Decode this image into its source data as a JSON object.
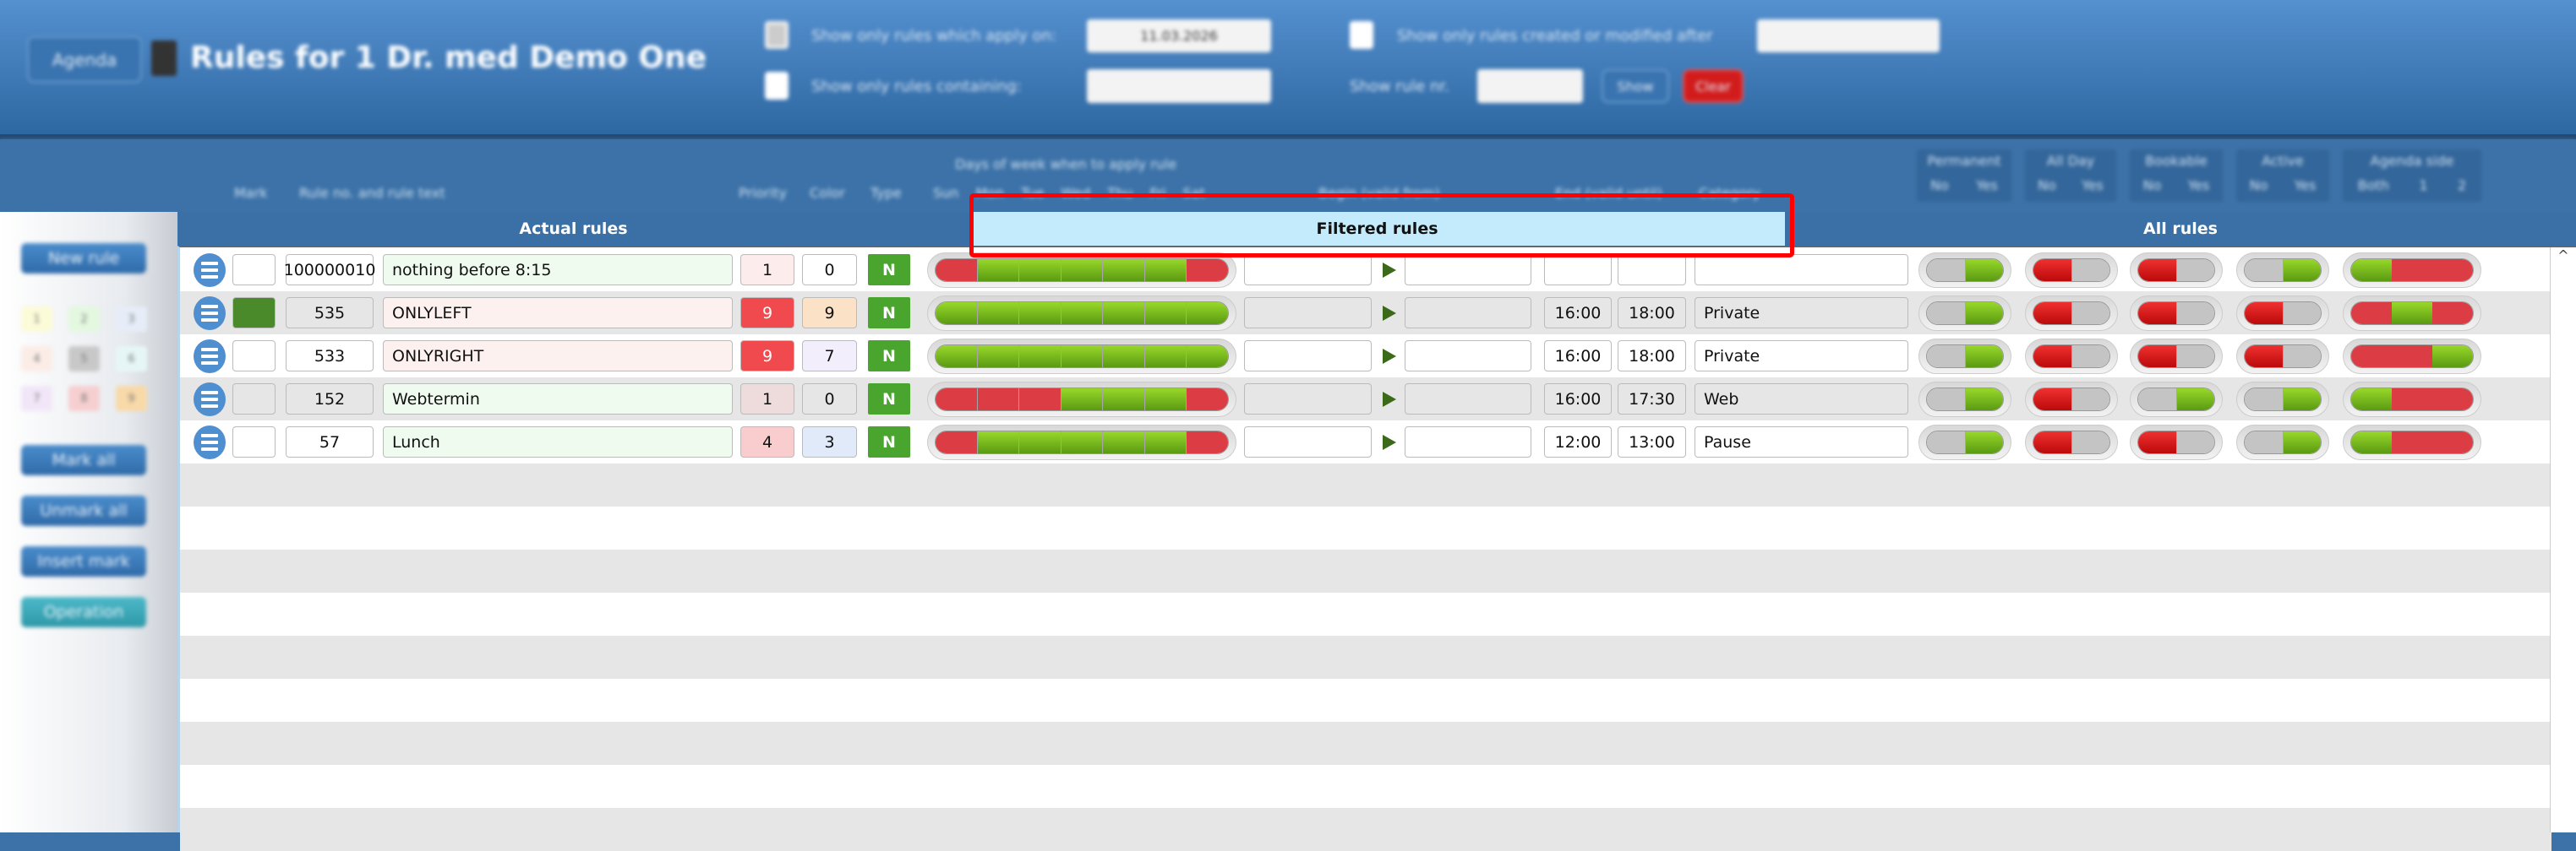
{
  "header": {
    "agenda_button": "Agenda",
    "title": "Rules for 1 Dr. med Demo One",
    "filter_apply_on_label": "Show only rules which apply on:",
    "filter_apply_on_checked": true,
    "filter_apply_on_date": "11.03.2026",
    "filter_modified_label": "Show only rules created or modified after",
    "filter_modified_checked": false,
    "filter_modified_date": "",
    "filter_containing_label": "Show only rules containing:",
    "filter_containing_value": "",
    "show_rule_nr_label": "Show rule nr.",
    "show_rule_nr_value": "",
    "show_button": "Show",
    "clear_button": "Clear"
  },
  "columns": {
    "mark": "Mark",
    "rule": "Rule no. and rule text",
    "priority": "Priority",
    "color": "Color",
    "type": "Type",
    "days_title": "Days of week when to apply rule",
    "days": [
      "Sun",
      "Mon",
      "Tue",
      "Wed",
      "Thu",
      "Fri",
      "Sat"
    ],
    "begin": "Begin (valid from)",
    "end": "End (valid until)",
    "category": "Category",
    "permanent": "Permanent",
    "all_day": "All Day",
    "bookable": "Bookable",
    "active": "Active",
    "agenda_side": "Agenda side",
    "no": "No",
    "yes": "Yes",
    "both": "Both",
    "one": "1",
    "two": "2"
  },
  "tabs": [
    {
      "label": "Actual rules",
      "active": false
    },
    {
      "label": "Filtered rules",
      "active": true
    },
    {
      "label": "All rules",
      "active": false
    }
  ],
  "sidebar": {
    "new_rule": "New rule",
    "palette": [
      {
        "n": "1",
        "color": "#fbfbd8"
      },
      {
        "n": "2",
        "color": "#e3f8df"
      },
      {
        "n": "3",
        "color": "#e6ecf8"
      },
      {
        "n": "4",
        "color": "#fbece6"
      },
      {
        "n": "5",
        "color": "#c8c8c8"
      },
      {
        "n": "6",
        "color": "#e6f6f6"
      },
      {
        "n": "7",
        "color": "#f1e6f8"
      },
      {
        "n": "8",
        "color": "#f6cfd0"
      },
      {
        "n": "9",
        "color": "#f8d9a8"
      }
    ],
    "mark_all": "Mark all",
    "unmark_all": "Unmark all",
    "insert_mark": "Insert mark",
    "operation": "Operation"
  },
  "rules": [
    {
      "mark": "#ffffff",
      "no": "100000010",
      "text": "nothing before 8:15",
      "text_bg": "#f0fbef",
      "priority": "1",
      "priority_bg": "#fdecec",
      "color": "0",
      "color_bg": "#ffffff",
      "type": "N",
      "days": [
        0,
        1,
        1,
        1,
        1,
        1,
        0
      ],
      "begin": "",
      "end": "",
      "start": "",
      "stop": "",
      "category": "",
      "permanent": 1,
      "all_day": 0,
      "bookable": 0,
      "active": 1,
      "side": "Both"
    },
    {
      "mark": "#4a8a2a",
      "no": "535",
      "text": "ONLYLEFT",
      "text_bg": "#fdf1ef",
      "priority": "9",
      "priority_bg": "#f04a4e",
      "color": "9",
      "color_bg": "#fbe1c6",
      "type": "N",
      "days": [
        1,
        1,
        1,
        1,
        1,
        1,
        1
      ],
      "begin": "",
      "end": "",
      "start": "16:00",
      "stop": "18:00",
      "category": "Private",
      "permanent": 1,
      "all_day": 0,
      "bookable": 0,
      "active": 0,
      "side": "1"
    },
    {
      "mark": "#ffffff",
      "no": "533",
      "text": "ONLYRIGHT",
      "text_bg": "#fdf1ef",
      "priority": "9",
      "priority_bg": "#f04a4e",
      "color": "7",
      "color_bg": "#f3eefc",
      "type": "N",
      "days": [
        1,
        1,
        1,
        1,
        1,
        1,
        1
      ],
      "begin": "",
      "end": "",
      "start": "16:00",
      "stop": "18:00",
      "category": "Private",
      "permanent": 1,
      "all_day": 0,
      "bookable": 0,
      "active": 0,
      "side": "2"
    },
    {
      "mark": "#e6e6e6",
      "no": "152",
      "text": "Webtermin",
      "text_bg": "#f0fbef",
      "priority": "1",
      "priority_bg": "#eedcdc",
      "color": "0",
      "color_bg": "#e6e6e6",
      "type": "N",
      "days": [
        0,
        0,
        0,
        1,
        1,
        1,
        0
      ],
      "begin": "",
      "end": "",
      "start": "16:00",
      "stop": "17:30",
      "category": "Web",
      "permanent": 1,
      "all_day": 0,
      "bookable": 1,
      "active": 1,
      "side": "Both"
    },
    {
      "mark": "#ffffff",
      "no": "57",
      "text": "Lunch",
      "text_bg": "#f0fbef",
      "priority": "4",
      "priority_bg": "#f9cdcd",
      "color": "3",
      "color_bg": "#e0eaf8",
      "type": "N",
      "days": [
        0,
        1,
        1,
        1,
        1,
        1,
        0
      ],
      "begin": "",
      "end": "",
      "start": "12:00",
      "stop": "13:00",
      "category": "Pause",
      "permanent": 1,
      "all_day": 0,
      "bookable": 0,
      "active": 1,
      "side": "Both"
    }
  ],
  "scroll_up": "^"
}
